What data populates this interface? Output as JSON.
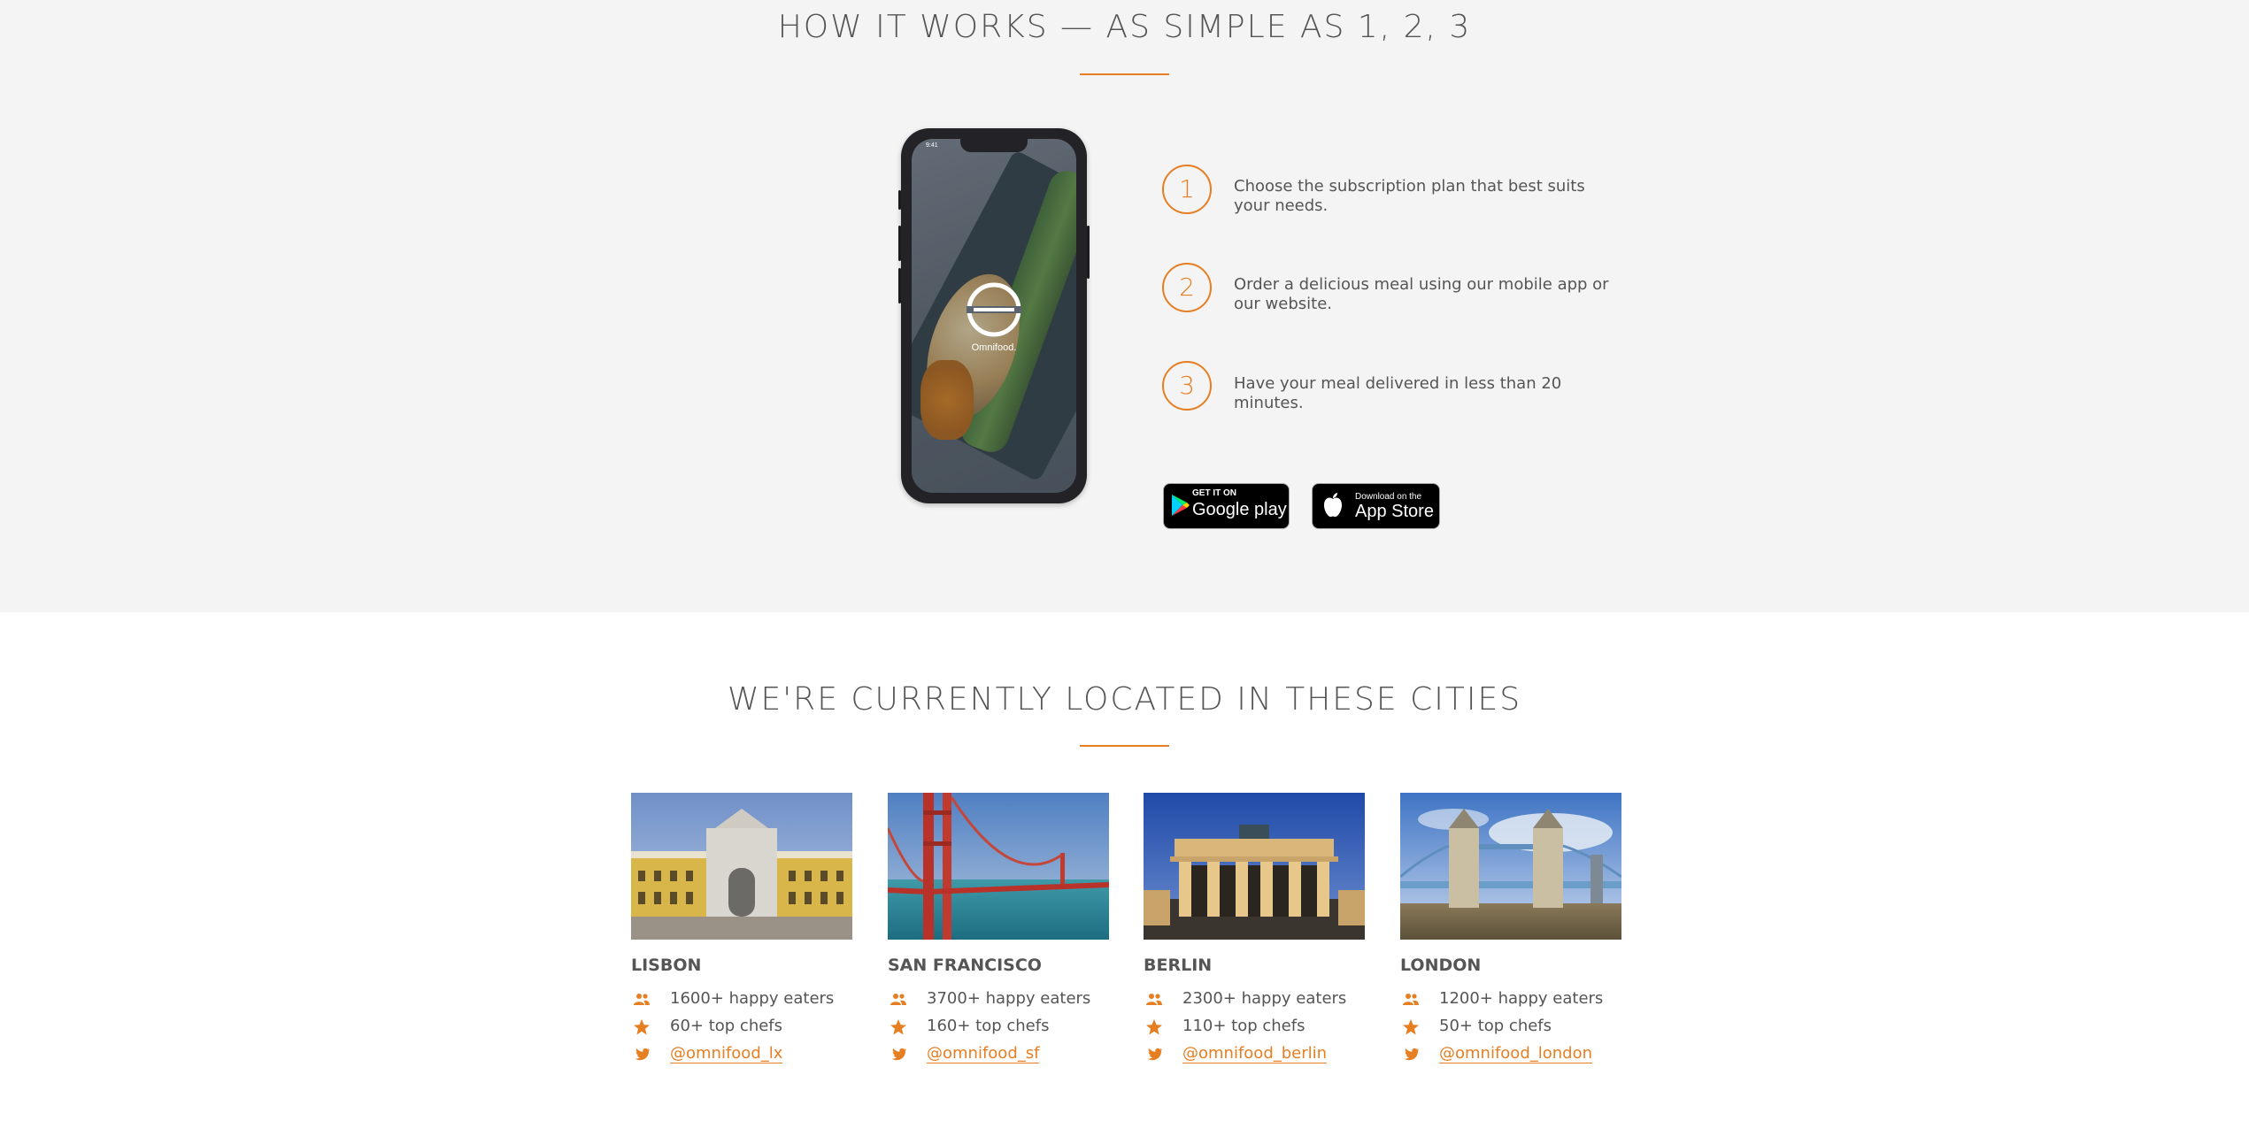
{
  "how_it_works": {
    "title": "HOW IT WORKS — AS SIMPLE AS 1, 2, 3",
    "phone": {
      "time": "9:41",
      "brand": "Omnifood."
    },
    "steps": [
      {
        "num": "1",
        "text": "Choose the subscription plan that best suits your needs."
      },
      {
        "num": "2",
        "text": "Order a delicious meal using our mobile app or our website."
      },
      {
        "num": "3",
        "text": "Have your meal delivered in less than 20 minutes."
      }
    ],
    "stores": {
      "google": {
        "small": "GET IT ON",
        "big": "Google play"
      },
      "apple": {
        "small": "Download on the",
        "big": "App Store"
      }
    }
  },
  "cities": {
    "title": "WE'RE CURRENTLY LOCATED IN THESE CITIES",
    "items": [
      {
        "name": "LISBON",
        "eaters": "1600+ happy eaters",
        "chefs": "60+ top chefs",
        "twitter": "@omnifood_lx"
      },
      {
        "name": "SAN FRANCISCO",
        "eaters": "3700+ happy eaters",
        "chefs": "160+ top chefs",
        "twitter": "@omnifood_sf"
      },
      {
        "name": "BERLIN",
        "eaters": "2300+ happy eaters",
        "chefs": "110+ top chefs",
        "twitter": "@omnifood_berlin"
      },
      {
        "name": "LONDON",
        "eaters": "1200+ happy eaters",
        "chefs": "50+ top chefs",
        "twitter": "@omnifood_london"
      }
    ]
  },
  "colors": {
    "accent": "#e67e22",
    "section_bg": "#f4f4f4",
    "text": "#555555"
  },
  "icons": {
    "eaters": "people-icon",
    "chefs": "star-icon",
    "twitter": "twitter-icon"
  }
}
